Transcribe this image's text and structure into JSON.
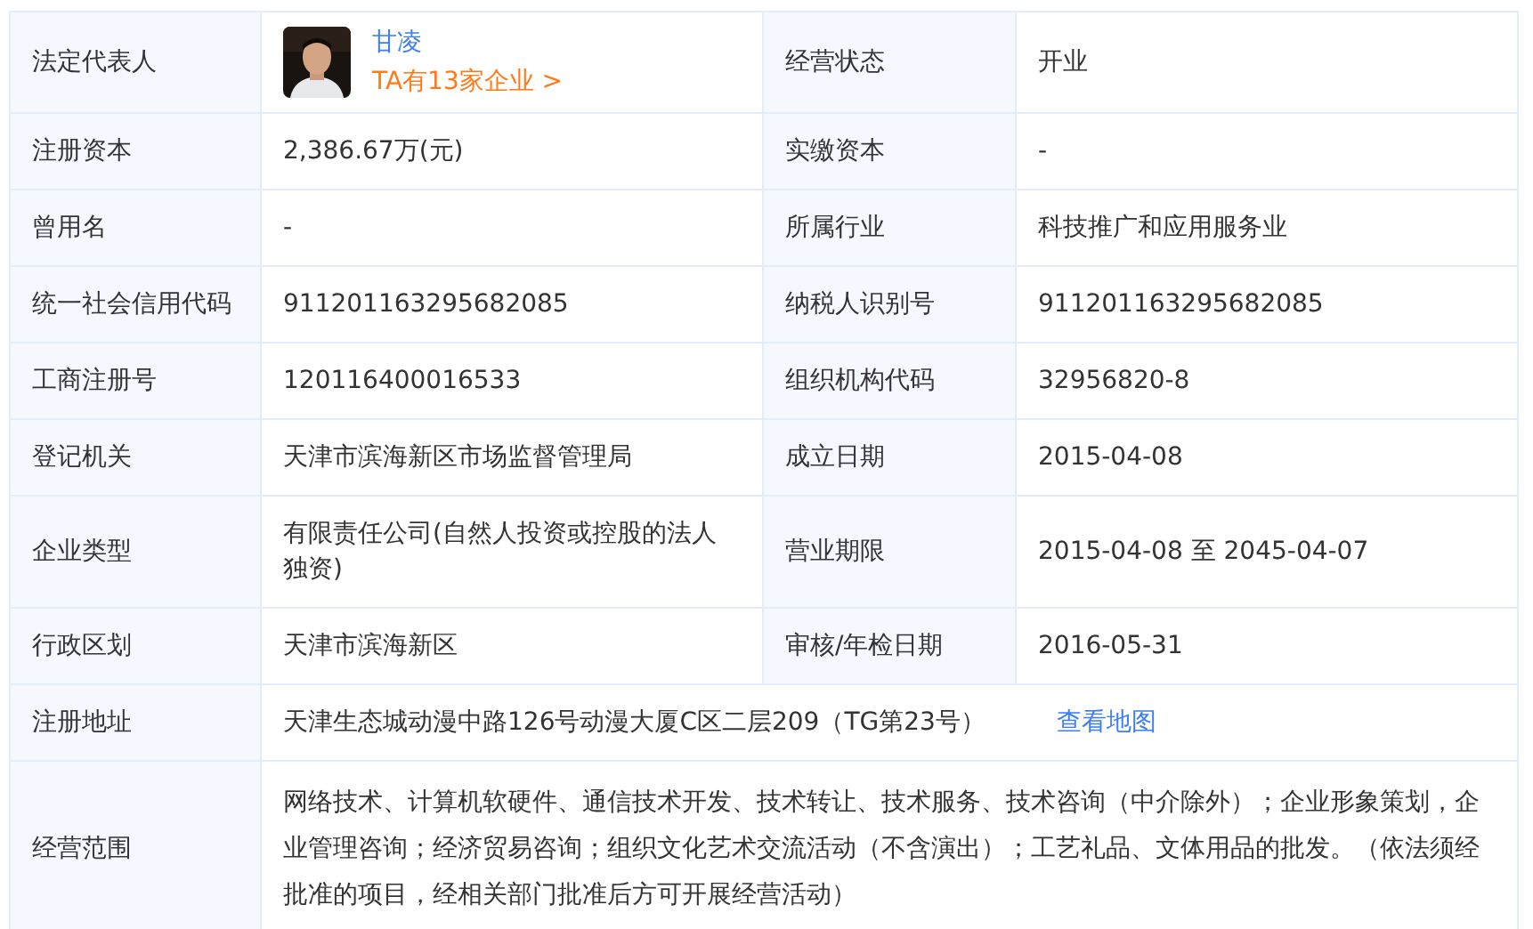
{
  "rows": [
    {
      "kind": "person",
      "label": "法定代表人",
      "name": "甘凌",
      "link": "TA有13家企业 >",
      "label_2": "经营状态",
      "value_2": "开业"
    },
    {
      "kind": "pair",
      "label": "注册资本",
      "value": "2,386.67万(元)",
      "label_2": "实缴资本",
      "value_2": "-"
    },
    {
      "kind": "pair",
      "label": "曾用名",
      "value": "-",
      "label_2": "所属行业",
      "value_2": "科技推广和应用服务业"
    },
    {
      "kind": "pair",
      "label": "统一社会信用代码",
      "value": "911201163295682085",
      "label_2": "纳税人识别号",
      "value_2": "911201163295682085"
    },
    {
      "kind": "pair",
      "label": "工商注册号",
      "value": "120116400016533",
      "label_2": "组织机构代码",
      "value_2": "32956820-8"
    },
    {
      "kind": "pair",
      "label": "登记机关",
      "value": "天津市滨海新区市场监督管理局",
      "label_2": "成立日期",
      "value_2": "2015-04-08"
    },
    {
      "kind": "pair",
      "label": "企业类型",
      "value": "有限责任公司(自然人投资或控股的法人独资)",
      "label_2": "营业期限",
      "value_2": "2015-04-08 至 2045-04-07"
    },
    {
      "kind": "pair",
      "label": "行政区划",
      "value": "天津市滨海新区",
      "label_2": "审核/年检日期",
      "value_2": "2016-05-31"
    },
    {
      "kind": "address",
      "label": "注册地址",
      "value": "天津生态城动漫中路126号动漫大厦C区二层209（TG第23号）",
      "link": "查看地图"
    },
    {
      "kind": "wide",
      "label": "经营范围",
      "value": "网络技术、计算机软硬件、通信技术开发、技术转让、技术服务、技术咨询（中介除外）；企业形象策划，企业管理咨询；经济贸易咨询；组织文化艺术交流活动（不含演出）；工艺礼品、文体用品的批发。（依法须经批准的项目，经相关部门批准后方可开展经营活动）"
    }
  ]
}
